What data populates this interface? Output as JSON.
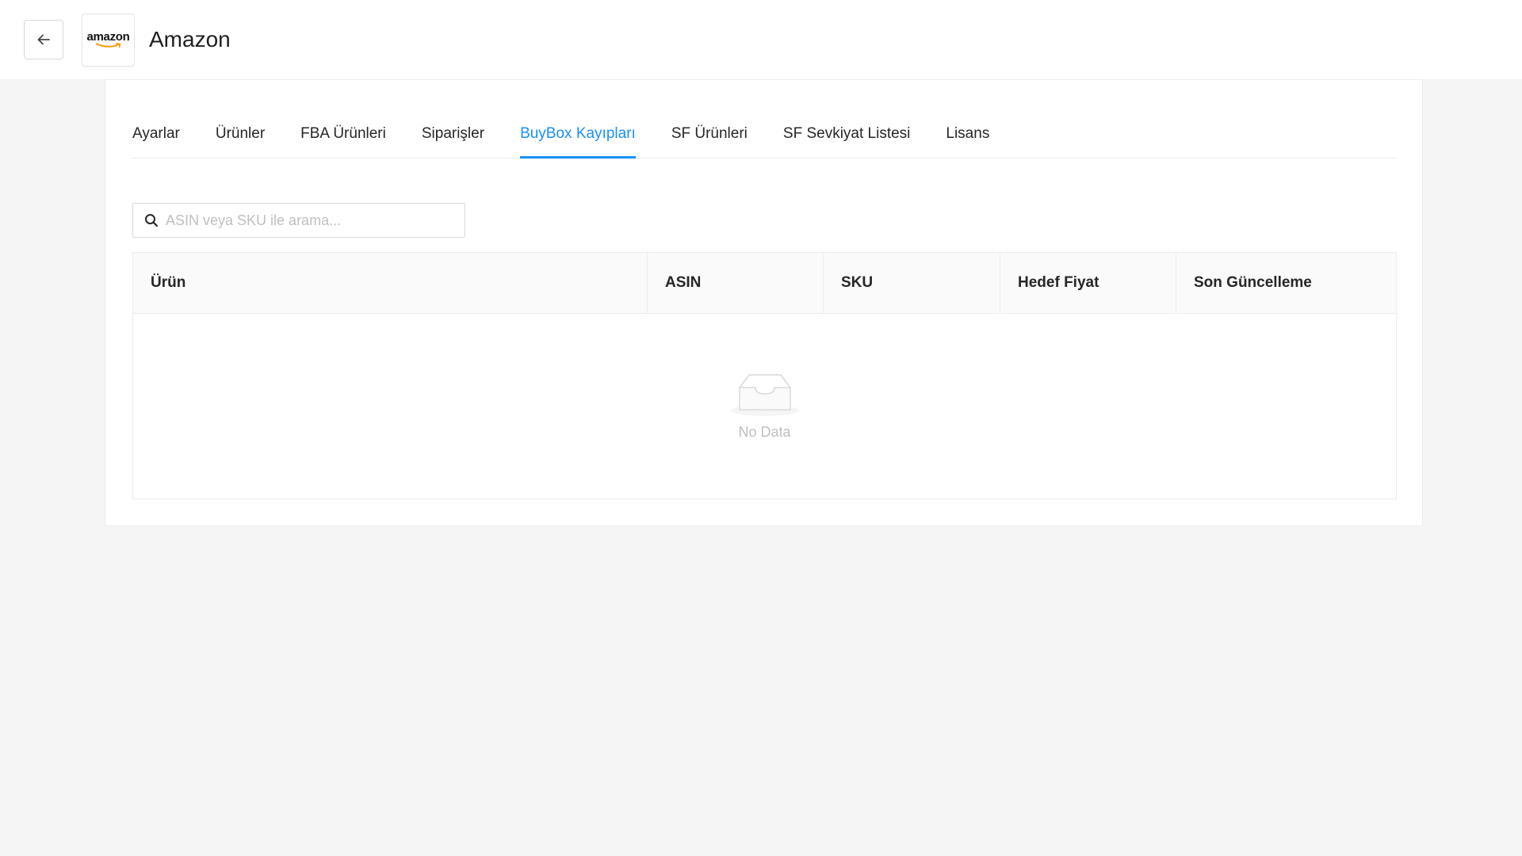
{
  "header": {
    "title": "Amazon",
    "logo_text": "amazon"
  },
  "tabs": [
    {
      "label": "Ayarlar",
      "active": false
    },
    {
      "label": "Ürünler",
      "active": false
    },
    {
      "label": "FBA Ürünleri",
      "active": false
    },
    {
      "label": "Siparişler",
      "active": false
    },
    {
      "label": "BuyBox Kayıpları",
      "active": true
    },
    {
      "label": "SF Ürünleri",
      "active": false
    },
    {
      "label": "SF Sevkiyat Listesi",
      "active": false
    },
    {
      "label": "Lisans",
      "active": false
    }
  ],
  "search": {
    "placeholder": "ASIN veya SKU ile arama...",
    "value": ""
  },
  "table": {
    "columns": [
      "Ürün",
      "ASIN",
      "SKU",
      "Hedef Fiyat",
      "Son Güncelleme"
    ],
    "rows": [],
    "empty_text": "No Data"
  },
  "colors": {
    "accent": "#1890ff",
    "page_bg": "#f5f5f5",
    "logo_smile": "#ff9900"
  },
  "icons": {
    "back": "arrow-left-icon",
    "search": "search-icon",
    "empty": "empty-inbox-icon"
  }
}
